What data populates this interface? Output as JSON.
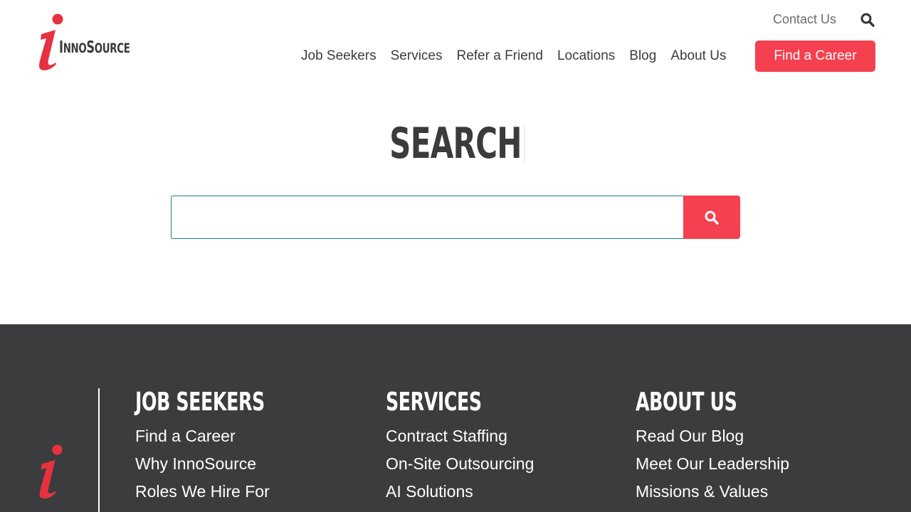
{
  "brand": {
    "name_lead": "I",
    "name_mid": "NNO",
    "name_cap": "S",
    "name_tail": "OURCE",
    "accent_color": "#f4404f",
    "dark_color": "#3b3c3e"
  },
  "header": {
    "contact_label": "Contact Us",
    "search_icon": "search-icon",
    "nav": [
      {
        "label": "Job Seekers"
      },
      {
        "label": "Services"
      },
      {
        "label": "Refer a Friend"
      },
      {
        "label": "Locations"
      },
      {
        "label": "Blog"
      },
      {
        "label": "About Us"
      }
    ],
    "cta_label": "Find a Career"
  },
  "search": {
    "title": "SEARCH",
    "input_value": "",
    "button_icon": "search-icon"
  },
  "footer": {
    "columns": [
      {
        "heading": "JOB SEEKERS",
        "links": [
          "Find a Career",
          "Why InnoSource",
          "Roles We Hire For"
        ]
      },
      {
        "heading": "SERVICES",
        "links": [
          "Contract Staffing",
          "On-Site Outsourcing",
          "AI Solutions"
        ]
      },
      {
        "heading": "ABOUT US",
        "links": [
          "Read Our Blog",
          "Meet Our Leadership",
          "Missions & Values"
        ]
      }
    ]
  }
}
